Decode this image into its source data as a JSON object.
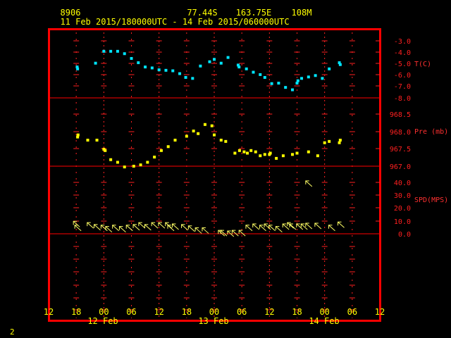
{
  "header": {
    "station_id": "8906",
    "lat": "77.44S",
    "lon": "163.75E",
    "elevation": "108M",
    "period": "11 Feb 2015/180000UTC - 14 Feb 2015/060000UTC",
    "corner_mark": "2"
  },
  "colors": {
    "frame": "#ff0000",
    "tick": "#ff2020",
    "label": "#ffff00",
    "temperature": "#00e5ff",
    "pressure": "#ffff00",
    "wind": "#ffff66"
  },
  "chart_data": {
    "type": "scatter",
    "x_unit": "hours from 11 Feb 2015 12UTC",
    "x_range": [
      0,
      72
    ],
    "x_tick_labels": [
      "12",
      "18",
      "00",
      "06",
      "12",
      "18",
      "00",
      "06",
      "12",
      "18",
      "00",
      "06",
      "12"
    ],
    "date_labels": [
      "12 Feb",
      "13 Feb",
      "14 Feb"
    ],
    "panels": [
      {
        "name": "T(C)",
        "y_range": [
          -8.0,
          -2.0
        ],
        "ticks": [
          "-3.0",
          "-4.0",
          "-5.0",
          "-6.0",
          "-7.0",
          "-8.0"
        ],
        "x": [
          6.2,
          6.3,
          10.2,
          12.0,
          13.5,
          15.0,
          16.5,
          18.0,
          19.5,
          21.0,
          22.5,
          24.0,
          25.5,
          27.0,
          28.5,
          29.8,
          31.3,
          33.0,
          35.0,
          36.0,
          37.5,
          39.0,
          41.2,
          41.4,
          43.0,
          44.5,
          46.0,
          47.0,
          48.5,
          50.0,
          51.5,
          53.0,
          54.0,
          54.2,
          55.0,
          56.5,
          58.0,
          59.5,
          61.0,
          63.2,
          63.4
        ],
        "values": [
          -4.75,
          -4.95,
          -4.35,
          -3.1,
          -3.1,
          -3.1,
          -3.35,
          -3.85,
          -4.3,
          -4.75,
          -4.85,
          -5.05,
          -5.1,
          -5.15,
          -5.45,
          -5.85,
          -5.95,
          -4.65,
          -4.2,
          -3.95,
          -4.35,
          -3.75,
          -4.55,
          -4.75,
          -4.95,
          -5.3,
          -5.55,
          -5.85,
          -6.5,
          -6.45,
          -6.9,
          -7.15,
          -6.45,
          -6.2,
          -5.95,
          -5.8,
          -5.65,
          -5.95,
          -4.95,
          -4.3,
          -4.5
        ]
      },
      {
        "name": "Pre (mb)",
        "y_range": [
          967.0,
          969.0
        ],
        "ticks": [
          "968.5",
          "968.0",
          "967.5",
          "967.0"
        ],
        "x": [
          6.3,
          6.4,
          8.5,
          10.5,
          12.0,
          12.3,
          13.5,
          15.0,
          16.5,
          18.5,
          20.0,
          21.5,
          23.0,
          24.5,
          26.0,
          27.5,
          30.0,
          31.5,
          32.5,
          34.0,
          35.5,
          36.0,
          37.5,
          38.5,
          40.5,
          41.5,
          42.5,
          43.2,
          44.0,
          45.0,
          46.0,
          47.0,
          48.0,
          48.2,
          49.5,
          51.0,
          53.0,
          54.0,
          56.5,
          58.5,
          60.0,
          61.0,
          63.2,
          63.4
        ],
        "values": [
          968.12,
          968.2,
          968.0,
          968.0,
          967.65,
          967.6,
          967.25,
          967.15,
          966.97,
          967.0,
          967.05,
          967.15,
          967.35,
          967.6,
          967.75,
          968.0,
          968.15,
          968.35,
          968.25,
          968.6,
          968.55,
          968.2,
          968.0,
          967.95,
          967.5,
          967.6,
          967.55,
          967.5,
          967.6,
          967.55,
          967.4,
          967.45,
          967.45,
          967.5,
          967.3,
          967.4,
          967.45,
          967.5,
          967.55,
          967.4,
          967.9,
          967.95,
          967.9,
          968.0
        ]
      },
      {
        "name": "SPD(MPS)",
        "y_range": [
          0.0,
          40.0
        ],
        "ticks": [
          "40.0",
          "30.0",
          "20.0",
          "10.0",
          "0.0"
        ],
        "x": [
          6.0,
          6.3,
          9.0,
          10.5,
          12.0,
          13.0,
          14.5,
          16.0,
          17.5,
          19.0,
          20.2,
          21.5,
          23.0,
          24.5,
          26.0,
          26.5,
          27.5,
          29.5,
          31.0,
          32.5,
          34.0,
          37.5,
          38.0,
          39.5,
          40.5,
          42.0,
          43.5,
          45.0,
          46.5,
          47.5,
          48.5,
          50.0,
          51.5,
          52.5,
          53.0,
          54.5,
          55.5,
          56.5,
          58.5,
          61.5,
          63.5
        ],
        "values": [
          7.5,
          4.5,
          6.5,
          5.0,
          4.5,
          3.5,
          4.5,
          3.5,
          4.5,
          5.0,
          6.5,
          5.0,
          6.5,
          6.5,
          6.5,
          4.5,
          5.5,
          5.0,
          4.0,
          2.5,
          2.5,
          0.5,
          0.5,
          0.0,
          0.5,
          0.5,
          4.5,
          5.5,
          4.5,
          5.5,
          4.5,
          3.5,
          5.5,
          6.5,
          5.5,
          5.5,
          5.5,
          6.0,
          6.0,
          4.5,
          7.0
        ],
        "extra_x": [
          56.5
        ],
        "extra_values": [
          39.0
        ]
      }
    ]
  }
}
